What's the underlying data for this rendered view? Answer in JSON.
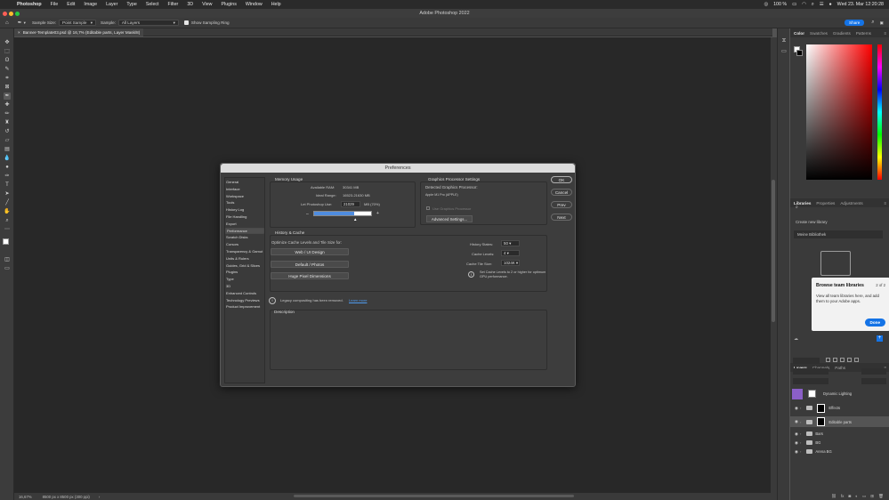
{
  "menubar": {
    "app": "Photoshop",
    "items": [
      "File",
      "Edit",
      "Image",
      "Layer",
      "Type",
      "Select",
      "Filter",
      "3D",
      "View",
      "Plugins",
      "Window",
      "Help"
    ],
    "battery": "100 %",
    "clock": "Wed 23. Mar 12:20:28"
  },
  "window": {
    "title": "Adobe Photoshop 2022"
  },
  "options": {
    "sample_size_label": "Sample Size:",
    "sample_size_value": "Point Sample",
    "sample_label": "Sample:",
    "sample_value": "All Layers",
    "show_ring": "Show Sampling Ring",
    "share": "Share"
  },
  "document": {
    "tab": "Banner-Template03.psd @ 16,7% (Editable parts, Layer Mask/8)",
    "zoom": "16,67%",
    "size": "8500 px x 8500 px (300 ppi)"
  },
  "dialog": {
    "title": "Preferences",
    "categories": [
      "General",
      "Interface",
      "Workspace",
      "Tools",
      "History Log",
      "File Handling",
      "Export",
      "Performance",
      "Scratch Disks",
      "Cursors",
      "Transparency & Gamut",
      "Units & Rulers",
      "Guides, Grid & Slices",
      "Plugins",
      "Type",
      "3D",
      "Enhanced Controls",
      "Technology Previews",
      "Product Improvement"
    ],
    "selected_index": 7,
    "buttons": {
      "ok": "OK",
      "cancel": "Cancel",
      "prev": "Prev",
      "next": "Next"
    },
    "memory": {
      "heading": "Memory Usage",
      "available_label": "Available RAM:",
      "available_value": "30341 MB",
      "ideal_label": "Ideal Range:",
      "ideal_value": "16523-21630 MB",
      "let_label": "Let Photoshop Use:",
      "let_value": "21029",
      "let_suffix": "MB (70%)",
      "fill_fraction": 0.7,
      "minus": "–",
      "plus": "+"
    },
    "gpu": {
      "heading": "Graphics Processor Settings",
      "detected_label": "Detected Graphics Processor:",
      "detected_value": "Apple M1 Pro (APPLE)",
      "use_gp": "Use Graphics Processor",
      "advanced": "Advanced Settings..."
    },
    "history": {
      "heading": "History & Cache",
      "optimize": "Optimize Cache Levels and Tile Size for:",
      "btn1": "Web / UI Design",
      "btn2": "Default / Photos",
      "btn3": "Huge Pixel Dimensions",
      "states_label": "History States:",
      "states_value": "50",
      "cache_label": "Cache Levels:",
      "cache_value": "4",
      "tile_label": "Cache Tile Size:",
      "tile_value": "1024K",
      "tip": "Set Cache Levels to 2 or higher for optimum GPU performance."
    },
    "legacy": {
      "text": "Legacy compositing has been removed.",
      "link": "Learn more"
    },
    "description": "Description"
  },
  "panels": {
    "color_tabs": [
      "Color",
      "Swatches",
      "Gradients",
      "Patterns"
    ],
    "lib_tabs": [
      "Libraries",
      "Properties",
      "Adjustments"
    ],
    "create_library": "Create new library",
    "library_name": "Meine Bibliothek",
    "tooltip": {
      "title": "Browse team libraries",
      "counter": "2 of 2",
      "body": "View all team libraries here, and add them to your Adobe apps.",
      "done": "Done"
    },
    "layer_tabs": [
      "Layers",
      "Channels",
      "Paths"
    ],
    "layers": [
      {
        "name": "Dynamic Lighting",
        "type": "smart"
      },
      {
        "name": "Effects",
        "type": "group-mask"
      },
      {
        "name": "Editable parts",
        "type": "group-mask"
      },
      {
        "name": "Bars",
        "type": "group"
      },
      {
        "name": "BG",
        "type": "group"
      },
      {
        "name": "Arena BG",
        "type": "group"
      }
    ]
  },
  "colors": {
    "accent": "#1473e6",
    "selected_category": "#4e4e4e",
    "swatch_purple": "#8b5fc7"
  }
}
